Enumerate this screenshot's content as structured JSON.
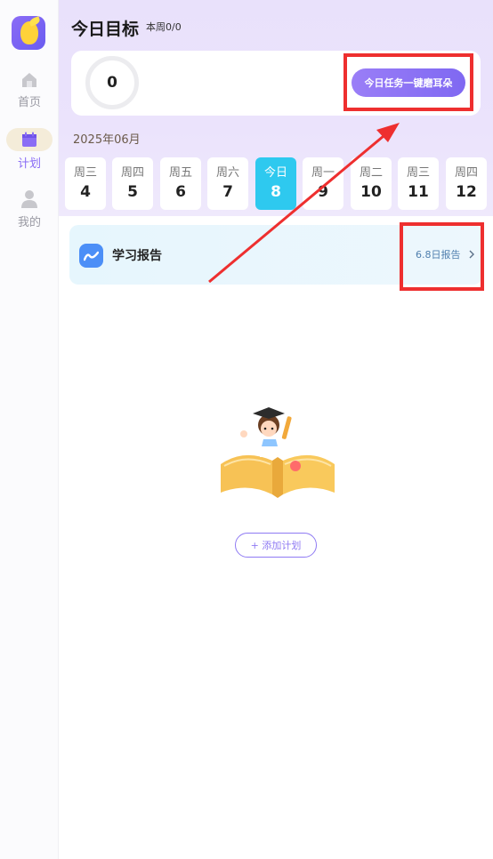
{
  "sidebar": {
    "items": [
      {
        "label": "首页",
        "icon": "home-icon"
      },
      {
        "label": "计划",
        "icon": "calendar-icon",
        "active": true
      },
      {
        "label": "我的",
        "icon": "user-icon"
      }
    ]
  },
  "header": {
    "title": "今日目标",
    "week_progress": "本周0/0"
  },
  "goal": {
    "count": "0",
    "cta_label": "今日任务一键磨耳朵"
  },
  "calendar": {
    "month": "2025年06月",
    "days": [
      {
        "weekday": "周三",
        "date": "4"
      },
      {
        "weekday": "周四",
        "date": "5"
      },
      {
        "weekday": "周五",
        "date": "6"
      },
      {
        "weekday": "周六",
        "date": "7"
      },
      {
        "weekday": "今日",
        "date": "8",
        "today": true
      },
      {
        "weekday": "周一",
        "date": "9"
      },
      {
        "weekday": "周二",
        "date": "10"
      },
      {
        "weekday": "周三",
        "date": "11"
      },
      {
        "weekday": "周四",
        "date": "12"
      }
    ]
  },
  "report": {
    "title": "学习报告",
    "link_label": "6.8日报告"
  },
  "empty_state": {
    "add_button": "+ 添加计划"
  },
  "colors": {
    "accent": "#8a6df5",
    "today": "#2ec9ef",
    "highlight": "#ee2f2f"
  }
}
